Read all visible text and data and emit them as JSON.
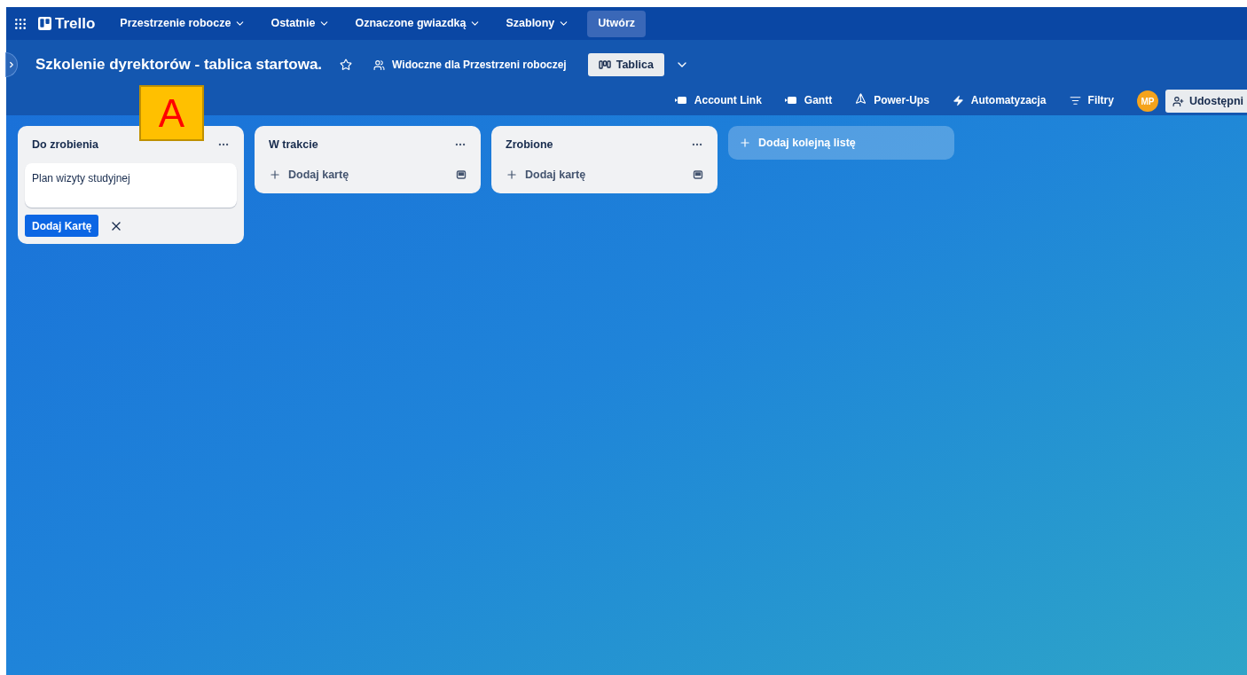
{
  "nav": {
    "app_name": "Trello",
    "menus": [
      {
        "label": "Przestrzenie robocze"
      },
      {
        "label": "Ostatnie"
      },
      {
        "label": "Oznaczone gwiazdką"
      },
      {
        "label": "Szablony"
      }
    ],
    "create_button": "Utwórz"
  },
  "board": {
    "title": "Szkolenie dyrektorów - tablica startowa.",
    "visibility": "Widoczne dla Przestrzeni roboczej",
    "view": "Tablica",
    "actions": [
      {
        "kind": "powerup",
        "label": "Account Link"
      },
      {
        "kind": "powerup",
        "label": "Gantt"
      },
      {
        "kind": "power-ups",
        "label": "Power-Ups"
      },
      {
        "kind": "automation",
        "label": "Automatyzacja"
      },
      {
        "kind": "filter",
        "label": "Filtry"
      }
    ],
    "member_initials": "MP",
    "share_button": "Udostępni"
  },
  "lists": [
    {
      "title": "Do zrobienia",
      "composer": {
        "value": "Plan wizyty studyjnej",
        "submit": "Dodaj Kartę"
      }
    },
    {
      "title": "W trakcie",
      "add_card": "Dodaj kartę"
    },
    {
      "title": "Zrobione",
      "add_card": "Dodaj kartę"
    }
  ],
  "add_list": "Dodaj kolejną listę",
  "annotation": "A"
}
